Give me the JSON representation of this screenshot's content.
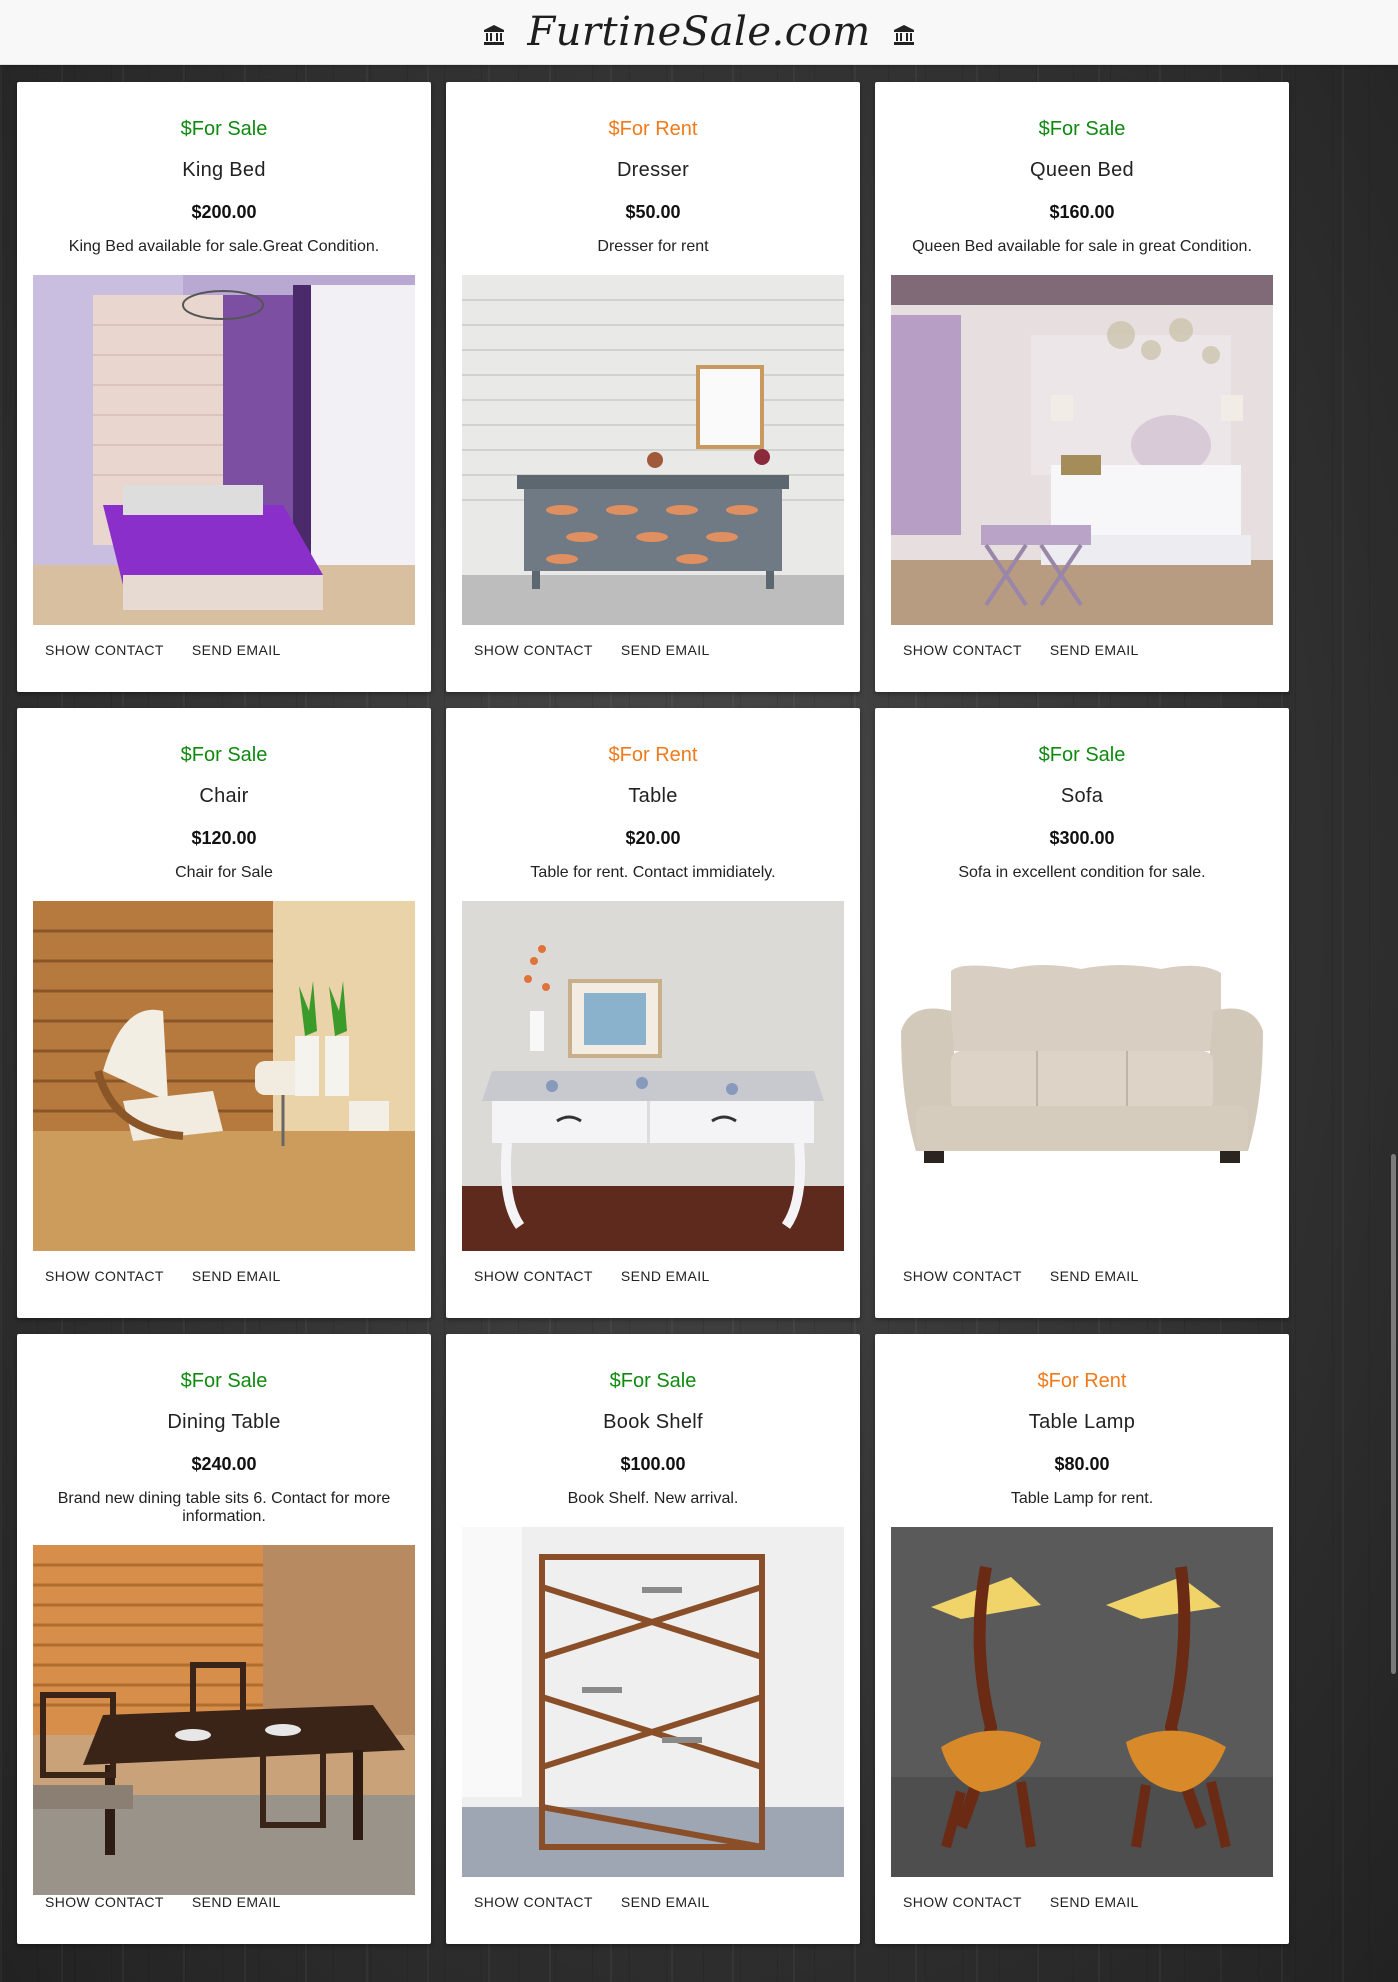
{
  "header": {
    "brand": "FurtineSale.com",
    "left_icon": "bank-icon",
    "right_icon": "bank-icon"
  },
  "colors": {
    "sale": "#0f8a0f",
    "rent": "#f07a1a"
  },
  "actions": {
    "show_contact": "SHOW CONTACT",
    "send_email": "SEND EMAIL"
  },
  "listings": [
    {
      "status": "$For Sale",
      "type": "sale",
      "name": "King Bed",
      "price": "$200.00",
      "description": "King Bed available for sale.Great Condition."
    },
    {
      "status": "$For Rent",
      "type": "rent",
      "name": "Dresser",
      "price": "$50.00",
      "description": "Dresser for rent"
    },
    {
      "status": "$For Sale",
      "type": "sale",
      "name": "Queen Bed",
      "price": "$160.00",
      "description": "Queen Bed available for sale in great Condition."
    },
    {
      "status": "$For Sale",
      "type": "sale",
      "name": "Chair",
      "price": "$120.00",
      "description": "Chair for Sale"
    },
    {
      "status": "$For Rent",
      "type": "rent",
      "name": "Table",
      "price": "$20.00",
      "description": "Table for rent. Contact immidiately."
    },
    {
      "status": "$For Sale",
      "type": "sale",
      "name": "Sofa",
      "price": "$300.00",
      "description": "Sofa in excellent condition for sale."
    },
    {
      "status": "$For Sale",
      "type": "sale",
      "name": "Dining Table",
      "price": "$240.00",
      "description": "Brand new dining table sits 6. Contact for more information."
    },
    {
      "status": "$For Sale",
      "type": "sale",
      "name": "Book Shelf",
      "price": "$100.00",
      "description": "Book Shelf. New arrival."
    },
    {
      "status": "$For Rent",
      "type": "rent",
      "name": "Table Lamp",
      "price": "$80.00",
      "description": "Table Lamp for rent."
    }
  ]
}
